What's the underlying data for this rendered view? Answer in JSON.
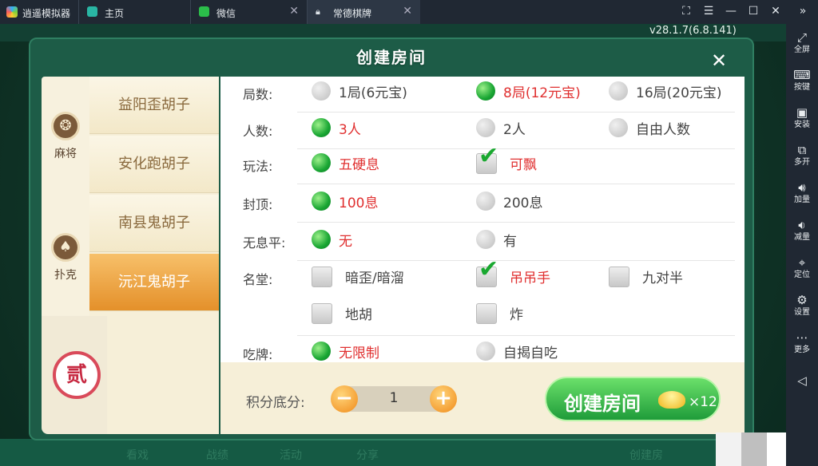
{
  "emulator": {
    "app_title": "逍遥模拟器",
    "tabs": [
      {
        "label": "主页",
        "icon": "home-icon"
      },
      {
        "label": "微信",
        "icon": "wechat-icon"
      },
      {
        "label": "常德棋牌",
        "icon": "lock-icon"
      }
    ],
    "window_controls": [
      "fullscreen-icon",
      "menu-icon",
      "minimize-icon",
      "maximize-icon",
      "close-icon"
    ],
    "version": "v28.1.7(6.8.141)",
    "sidebar": [
      {
        "label": "全屏",
        "icon": "fullscreen-icon"
      },
      {
        "label": "按键",
        "icon": "keyboard-icon"
      },
      {
        "label": "安装",
        "icon": "apk-install-icon"
      },
      {
        "label": "多开",
        "icon": "multi-instance-icon"
      },
      {
        "label": "加量",
        "icon": "volume-up-icon"
      },
      {
        "label": "减量",
        "icon": "volume-down-icon"
      },
      {
        "label": "定位",
        "icon": "location-icon"
      },
      {
        "label": "设置",
        "icon": "gear-icon"
      },
      {
        "label": "更多",
        "icon": "more-icon"
      },
      {
        "label": "",
        "icon": "back-icon"
      }
    ]
  },
  "background_items": [
    "看戏",
    "战绩",
    "活动",
    "分享",
    "创建房"
  ],
  "dialog": {
    "title": "创建房间",
    "categories": [
      {
        "label": "麻将",
        "icon": "mahjong-icon"
      },
      {
        "label": "扑克",
        "icon": "spade-icon"
      }
    ],
    "games": [
      "益阳歪胡子",
      "安化跑胡子",
      "南县鬼胡子",
      "沅江鬼胡子"
    ],
    "active_game": "沅江鬼胡子",
    "room_badge": "贰",
    "rows": [
      {
        "label": "局数:",
        "options": [
          {
            "text": "1局(6元宝)",
            "type": "radio",
            "selected": false
          },
          {
            "text": "8局(12元宝)",
            "type": "radio",
            "selected": true
          },
          {
            "text": "16局(20元宝)",
            "type": "radio",
            "selected": false
          }
        ]
      },
      {
        "label": "人数:",
        "options": [
          {
            "text": "3人",
            "type": "radio",
            "selected": true
          },
          {
            "text": "2人",
            "type": "radio",
            "selected": false
          },
          {
            "text": "自由人数",
            "type": "radio",
            "selected": false
          }
        ]
      },
      {
        "label": "玩法:",
        "options": [
          {
            "text": "五硬息",
            "type": "radio",
            "selected": true
          },
          {
            "text": "可飘",
            "type": "checkbox",
            "selected": true
          }
        ]
      },
      {
        "label": "封顶:",
        "options": [
          {
            "text": "100息",
            "type": "radio",
            "selected": true
          },
          {
            "text": "200息",
            "type": "radio",
            "selected": false
          }
        ]
      },
      {
        "label": "无息平:",
        "options": [
          {
            "text": "无",
            "type": "radio",
            "selected": true
          },
          {
            "text": "有",
            "type": "radio",
            "selected": false
          }
        ]
      },
      {
        "label": "名堂:",
        "options": [
          {
            "text": "暗歪/暗溜",
            "type": "checkbox",
            "selected": false
          },
          {
            "text": "吊吊手",
            "type": "checkbox",
            "selected": true
          },
          {
            "text": "九对半",
            "type": "checkbox",
            "selected": false
          },
          {
            "text": "地胡",
            "type": "checkbox",
            "selected": false
          },
          {
            "text": "炸",
            "type": "checkbox",
            "selected": false
          }
        ]
      },
      {
        "label": "吃牌:",
        "options": [
          {
            "text": "无限制",
            "type": "radio",
            "selected": true
          },
          {
            "text": "自揭自吃",
            "type": "radio",
            "selected": false
          }
        ]
      }
    ],
    "score": {
      "label": "积分底分:",
      "value": "1",
      "minus": "−",
      "plus": "+"
    },
    "create_button": {
      "label": "创建房间",
      "cost": "×12"
    }
  },
  "colors": {
    "selected_text": "#e03030",
    "accent_green": "#1f9c3a",
    "active_tab": "#e4902a"
  }
}
